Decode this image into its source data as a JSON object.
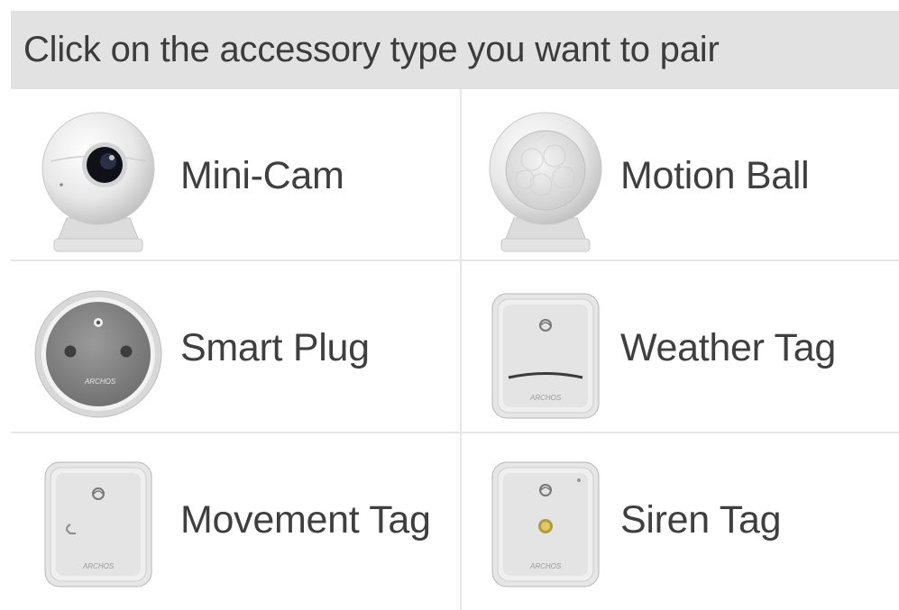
{
  "header": {
    "title": "Click on the accessory type you want to pair"
  },
  "accessories": [
    {
      "label": "Mini-Cam",
      "icon": "mini-cam-icon"
    },
    {
      "label": "Motion Ball",
      "icon": "motion-ball-icon"
    },
    {
      "label": "Smart Plug",
      "icon": "smart-plug-icon",
      "brand_text": "ARCHOS"
    },
    {
      "label": "Weather Tag",
      "icon": "weather-tag-icon",
      "brand_text": "ARCHOS"
    },
    {
      "label": "Movement Tag",
      "icon": "movement-tag-icon",
      "brand_text": "ARCHOS"
    },
    {
      "label": "Siren Tag",
      "icon": "siren-tag-icon",
      "brand_text": "ARCHOS"
    }
  ],
  "colors": {
    "header_bg": "#e2e2e2",
    "tile_bg": "#ffffff",
    "grid_lines": "#e6e6e6",
    "text": "#3f3f3f"
  }
}
